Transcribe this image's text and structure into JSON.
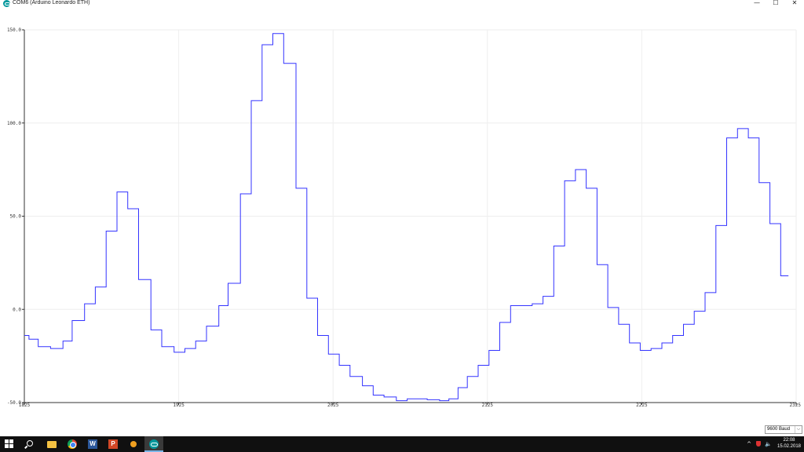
{
  "window": {
    "title": "COM6 (Arduino Leonardo ETH)",
    "controls": {
      "minimize": "—",
      "maximize": "☐",
      "close": "✕"
    }
  },
  "chart_data": {
    "type": "line",
    "title": "",
    "xlabel": "",
    "ylabel": "",
    "xlim": [
      1825,
      2325
    ],
    "ylim": [
      -50,
      150
    ],
    "x_ticks": [
      "1825",
      "1925",
      "2025",
      "2125",
      "2225",
      "2325"
    ],
    "y_ticks": [
      "150.0",
      "100.0",
      "50.0",
      "0.0",
      "-50.0"
    ],
    "grid": true,
    "line_color": "#3333ff",
    "series": [
      {
        "step_points": [
          [
            1825,
            -14
          ],
          [
            1828,
            -16
          ],
          [
            1834,
            -20
          ],
          [
            1842,
            -21
          ],
          [
            1850,
            -17
          ],
          [
            1856,
            -6
          ],
          [
            1864,
            3
          ],
          [
            1871,
            12
          ],
          [
            1878,
            42
          ],
          [
            1885,
            63
          ],
          [
            1892,
            54
          ],
          [
            1899,
            16
          ],
          [
            1907,
            -11
          ],
          [
            1914,
            -20
          ],
          [
            1922,
            -23
          ],
          [
            1929,
            -21
          ],
          [
            1936,
            -17
          ],
          [
            1943,
            -9
          ],
          [
            1951,
            2
          ],
          [
            1957,
            14
          ],
          [
            1965,
            62
          ],
          [
            1972,
            112
          ],
          [
            1979,
            142
          ],
          [
            1986,
            148
          ],
          [
            1993,
            132
          ],
          [
            2001,
            65
          ],
          [
            2008,
            6
          ],
          [
            2015,
            -14
          ],
          [
            2022,
            -24
          ],
          [
            2029,
            -30
          ],
          [
            2036,
            -36
          ],
          [
            2044,
            -41
          ],
          [
            2051,
            -46
          ],
          [
            2058,
            -47
          ],
          [
            2066,
            -49
          ],
          [
            2073,
            -48
          ],
          [
            2086,
            -48.5
          ],
          [
            2094,
            -49
          ],
          [
            2100,
            -48
          ],
          [
            2106,
            -42
          ],
          [
            2112,
            -36
          ],
          [
            2119,
            -30
          ],
          [
            2126,
            -22
          ],
          [
            2133,
            -7
          ],
          [
            2140,
            2
          ],
          [
            2154,
            3
          ],
          [
            2161,
            7
          ],
          [
            2168,
            34
          ],
          [
            2175,
            69
          ],
          [
            2182,
            75
          ],
          [
            2189,
            65
          ],
          [
            2196,
            24
          ],
          [
            2203,
            1
          ],
          [
            2210,
            -8
          ],
          [
            2217,
            -18
          ],
          [
            2224,
            -22
          ],
          [
            2231,
            -21
          ],
          [
            2238,
            -18
          ],
          [
            2245,
            -14
          ],
          [
            2252,
            -8
          ],
          [
            2259,
            -1
          ],
          [
            2266,
            9
          ],
          [
            2273,
            45
          ],
          [
            2280,
            92
          ],
          [
            2287,
            97
          ],
          [
            2294,
            92
          ],
          [
            2301,
            68
          ],
          [
            2308,
            46
          ],
          [
            2315,
            18
          ],
          [
            2320,
            18
          ]
        ]
      }
    ]
  },
  "bottom_bar": {
    "baud_rate": "9600 Baud",
    "dropdown_arrow": "⌵"
  },
  "taskbar": {
    "word_letter": "W",
    "ppt_letter": "P",
    "tray_chevron": "^",
    "tray_volume": "🔈",
    "clock_time": "22:08",
    "clock_date": "15.02.2018"
  }
}
